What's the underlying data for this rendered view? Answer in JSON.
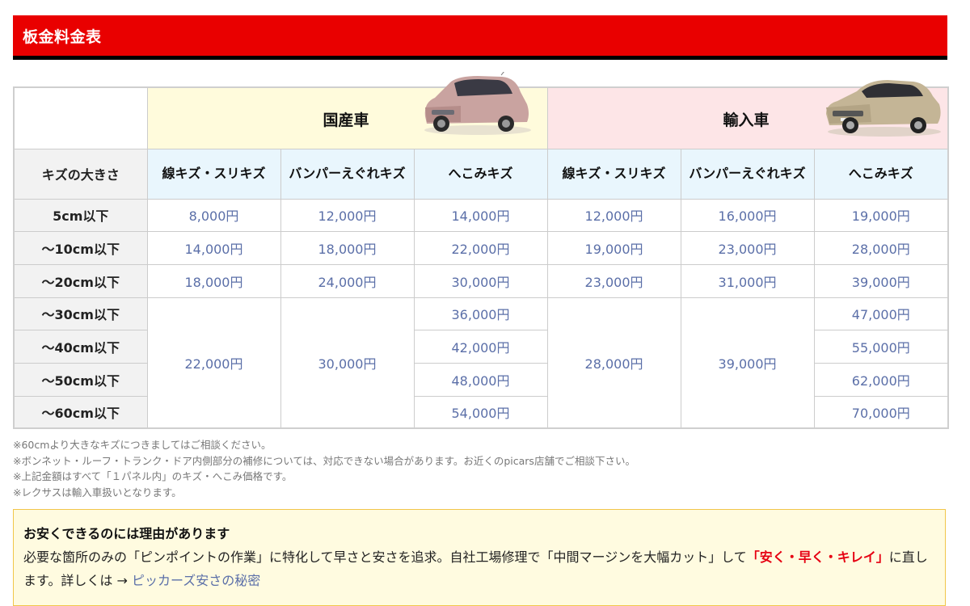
{
  "header": {
    "title": "板金料金表"
  },
  "table": {
    "categories": {
      "domestic": "国産車",
      "imported": "輸入車"
    },
    "row_header": "キズの大きさ",
    "column_headers": [
      "線キズ・スリキズ",
      "バンパーえぐれキズ",
      "へこみキズ",
      "線キズ・スリキズ",
      "バンパーえぐれキズ",
      "へこみキズ"
    ],
    "sizes": [
      "5cm以下",
      "～10cm以下",
      "～20cm以下",
      "～30cm以下",
      "～40cm以下",
      "～50cm以下",
      "～60cm以下"
    ],
    "domestic": {
      "line": [
        "8,000円",
        "14,000円",
        "18,000円"
      ],
      "line_merged": "22,000円",
      "bumper": [
        "12,000円",
        "18,000円",
        "24,000円"
      ],
      "bumper_merged": "30,000円",
      "dent": [
        "14,000円",
        "22,000円",
        "30,000円",
        "36,000円",
        "42,000円",
        "48,000円",
        "54,000円"
      ]
    },
    "imported": {
      "line": [
        "12,000円",
        "19,000円",
        "23,000円"
      ],
      "line_merged": "28,000円",
      "bumper": [
        "16,000円",
        "23,000円",
        "31,000円"
      ],
      "bumper_merged": "39,000円",
      "dent": [
        "19,000円",
        "28,000円",
        "39,000円",
        "47,000円",
        "55,000円",
        "62,000円",
        "70,000円"
      ]
    }
  },
  "notes": [
    "※60cmより大きなキズにつきましてはご相談ください。",
    "※ボンネット・ルーフ・トランク・ドア内側部分の補修については、対応できない場合があります。お近くのpicars店舗でご相談下さい。",
    "※上記金額はすべて「１パネル内」のキズ・へこみ価格です。",
    "※レクサスは輸入車扱いとなります。"
  ],
  "reason": {
    "title": "お安くできるのには理由があります",
    "body_part1": "必要な箇所のみの「ピンポイントの作業」に特化して早さと安さを追求。自社工場修理で「中間マージンを大幅カット」して",
    "emphasis": "「安く・早く・キレイ」",
    "body_part2": "に直します。詳しくは →",
    "link_text": "ピッカーズ安さの秘密"
  },
  "colors": {
    "header_red": "#e90000",
    "domestic_bg": "#fffbdc",
    "imported_bg": "#fde5e7",
    "subheader_bg": "#e9f6fd",
    "price_text": "#5b6fa8",
    "accent_red": "#e60012"
  }
}
